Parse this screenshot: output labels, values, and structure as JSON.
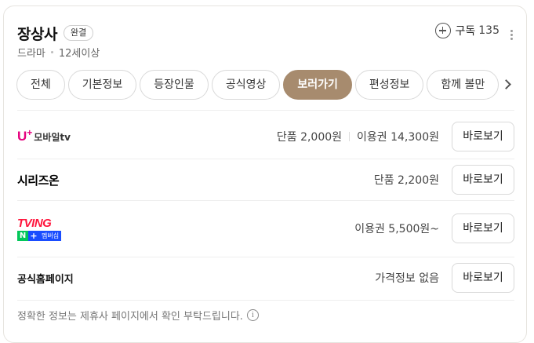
{
  "header": {
    "title": "장상사",
    "badge": "완결",
    "genre": "드라마",
    "rating": "12세이상",
    "subscribe_label": "구독",
    "subscribe_count": "135"
  },
  "tabs": [
    {
      "label": "전체",
      "active": false
    },
    {
      "label": "기본정보",
      "active": false
    },
    {
      "label": "등장인물",
      "active": false
    },
    {
      "label": "공식영상",
      "active": false
    },
    {
      "label": "보러가기",
      "active": true
    },
    {
      "label": "편성정보",
      "active": false
    },
    {
      "label": "함께 볼만",
      "active": false
    }
  ],
  "providers": [
    {
      "name": "U+모바일tv",
      "logo": {
        "u": "U",
        "plus": "+",
        "text": "모바일tv"
      },
      "price_single": "단품 2,000원",
      "price_pass": "이용권 14,300원",
      "button": "바로보기"
    },
    {
      "name": "시리즈온",
      "price_single": "단품 2,200원",
      "button": "바로보기"
    },
    {
      "name": "TVING",
      "logo": {
        "n": "N",
        "plus": "+",
        "membership": "멤버십"
      },
      "price_pass": "이용권 5,500원~",
      "button": "바로보기"
    },
    {
      "name": "공식홈페이지",
      "price_info": "가격정보 없음",
      "button": "바로보기"
    }
  ],
  "footer": {
    "notice": "정확한 정보는 제휴사 페이지에서 확인 부탁드립니다.",
    "info_icon": "i"
  },
  "colors": {
    "active_tab": "#a78b6e",
    "uplus": "#e6007e",
    "tving": "#ff153c",
    "naver_green": "#03c75a",
    "plus_blue": "#1a4dff"
  }
}
